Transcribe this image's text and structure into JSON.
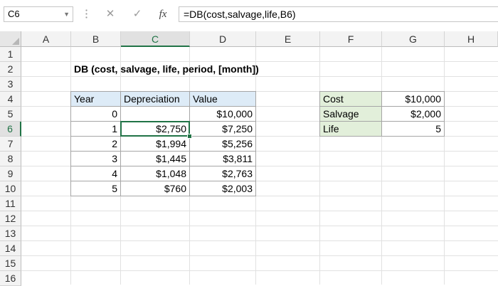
{
  "formula_bar": {
    "name_box": "C6",
    "formula": "=DB(cost,salvage,life,B6)",
    "cancel_icon": "close-icon",
    "enter_icon": "check-icon",
    "fx_label": "fx"
  },
  "columns": [
    "A",
    "B",
    "C",
    "D",
    "E",
    "F",
    "G",
    "H"
  ],
  "rows": [
    "1",
    "2",
    "3",
    "4",
    "5",
    "6",
    "7",
    "8",
    "9",
    "10",
    "11",
    "12",
    "13",
    "14",
    "15",
    "16"
  ],
  "selected": {
    "column": "C",
    "row": "6"
  },
  "sheet": {
    "title": "DB (cost, salvage, life, period, [month])",
    "table": {
      "headers": [
        "Year",
        "Depreciation",
        "Value"
      ],
      "rows": [
        [
          "0",
          "",
          "$10,000"
        ],
        [
          "1",
          "$2,750",
          "$7,250"
        ],
        [
          "2",
          "$1,994",
          "$5,256"
        ],
        [
          "3",
          "$1,445",
          "$3,811"
        ],
        [
          "4",
          "$1,048",
          "$2,763"
        ],
        [
          "5",
          "$760",
          "$2,003"
        ]
      ]
    },
    "inputs": [
      {
        "label": "Cost",
        "value": "$10,000"
      },
      {
        "label": "Salvage",
        "value": "$2,000"
      },
      {
        "label": "Life",
        "value": "5"
      }
    ]
  },
  "colors": {
    "accent": "#217346",
    "table_header_fill": "#ddebf7",
    "input_label_fill": "#e2efda"
  }
}
